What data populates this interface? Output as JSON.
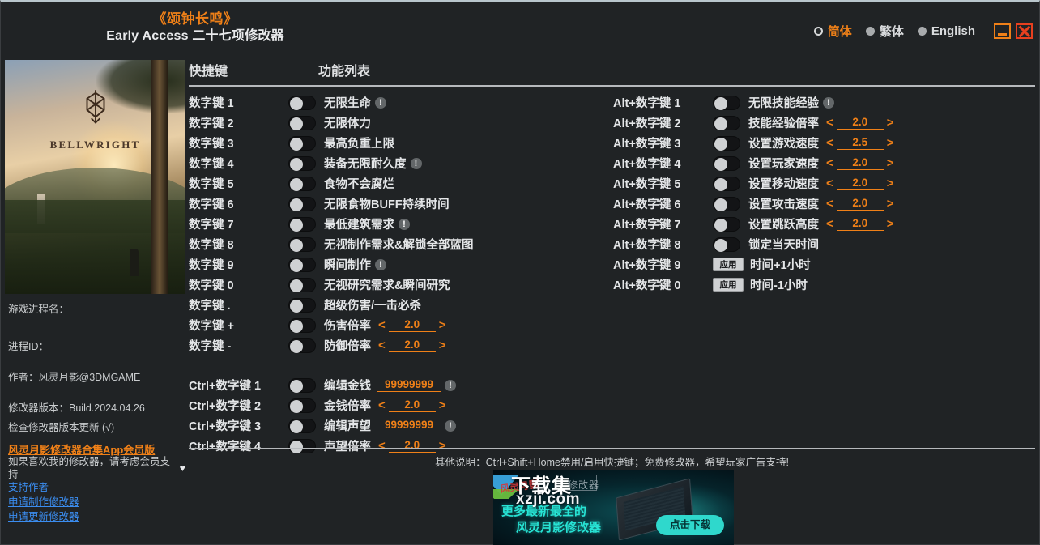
{
  "header": {
    "game_title": "《颂钟长鸣》",
    "sub_title": "Early Access 二十七项修改器",
    "languages": [
      {
        "label": "简体",
        "selected": true
      },
      {
        "label": "繁体",
        "selected": false
      },
      {
        "label": "English",
        "selected": false
      }
    ],
    "minimize_icon": "minimize-icon",
    "close_icon": "close-icon"
  },
  "sidebar": {
    "cover_brand": "BELLWRIGHT",
    "cover_logo_icon": "bell-logo-icon",
    "process_name_label": "游戏进程名：",
    "process_id_label": "进程ID：",
    "author_label": "作者：风灵月影@3DMGAME",
    "version_label": "修改器版本：Build.2024.04.26",
    "check_update_link": "检查修改器版本更新 (√)",
    "vip_app_link": "风灵月影修改器合集App会员版",
    "support_note": "如果喜欢我的修改器，请考虑会员支持",
    "heart_icon": "heart-icon",
    "links": [
      "支持作者",
      "申请制作修改器",
      "申请更新修改器"
    ]
  },
  "main": {
    "col_header_hotkey": "快捷键",
    "col_header_functions": "功能列表",
    "left_rows": [
      {
        "hotkey": "数字键 1",
        "control": "toggle",
        "state": "off",
        "label": "无限生命",
        "warn": true
      },
      {
        "hotkey": "数字键 2",
        "control": "toggle",
        "state": "off",
        "label": "无限体力",
        "warn": false
      },
      {
        "hotkey": "数字键 3",
        "control": "toggle",
        "state": "off",
        "label": "最高负重上限",
        "warn": false
      },
      {
        "hotkey": "数字键 4",
        "control": "toggle",
        "state": "off",
        "label": "装备无限耐久度",
        "warn": true
      },
      {
        "hotkey": "数字键 5",
        "control": "toggle",
        "state": "off",
        "label": "食物不会腐烂",
        "warn": false
      },
      {
        "hotkey": "数字键 6",
        "control": "toggle",
        "state": "off",
        "label": "无限食物BUFF持续时间",
        "warn": false
      },
      {
        "hotkey": "数字键 7",
        "control": "toggle",
        "state": "off",
        "label": "最低建筑需求",
        "warn": true
      },
      {
        "hotkey": "数字键 8",
        "control": "toggle",
        "state": "off",
        "label": "无视制作需求&解锁全部蓝图",
        "warn": false
      },
      {
        "hotkey": "数字键 9",
        "control": "toggle",
        "state": "off",
        "label": "瞬间制作",
        "warn": true
      },
      {
        "hotkey": "数字键 0",
        "control": "toggle",
        "state": "off",
        "label": "无视研究需求&瞬间研究",
        "warn": false
      },
      {
        "hotkey": "数字键 .",
        "control": "toggle",
        "state": "off",
        "label": "超级伤害/一击必杀",
        "warn": false
      },
      {
        "hotkey": "数字键 +",
        "control": "toggle",
        "state": "off",
        "label": "伤害倍率",
        "warn": false,
        "spinner": "2.0"
      },
      {
        "hotkey": "数字键 -",
        "control": "toggle",
        "state": "off",
        "label": "防御倍率",
        "warn": false,
        "spinner": "2.0"
      }
    ],
    "left_rows_group2": [
      {
        "hotkey": "Ctrl+数字键 1",
        "control": "toggle",
        "state": "off",
        "label": "编辑金钱",
        "warn": true,
        "field": "99999999"
      },
      {
        "hotkey": "Ctrl+数字键 2",
        "control": "toggle",
        "state": "off",
        "label": "金钱倍率",
        "warn": false,
        "spinner": "2.0"
      },
      {
        "hotkey": "Ctrl+数字键 3",
        "control": "toggle",
        "state": "off",
        "label": "编辑声望",
        "warn": true,
        "field": "99999999"
      },
      {
        "hotkey": "Ctrl+数字键 4",
        "control": "toggle",
        "state": "off",
        "label": "声望倍率",
        "warn": false,
        "spinner": "2.0"
      }
    ],
    "right_rows": [
      {
        "hotkey": "Alt+数字键 1",
        "control": "toggle",
        "state": "off",
        "label": "无限技能经验",
        "warn": true
      },
      {
        "hotkey": "Alt+数字键 2",
        "control": "toggle",
        "state": "off",
        "label": "技能经验倍率",
        "warn": false,
        "spinner": "2.0"
      },
      {
        "hotkey": "Alt+数字键 3",
        "control": "toggle",
        "state": "off",
        "label": "设置游戏速度",
        "warn": false,
        "spinner": "2.5"
      },
      {
        "hotkey": "Alt+数字键 4",
        "control": "toggle",
        "state": "off",
        "label": "设置玩家速度",
        "warn": false,
        "spinner": "2.0"
      },
      {
        "hotkey": "Alt+数字键 5",
        "control": "toggle",
        "state": "off",
        "label": "设置移动速度",
        "warn": false,
        "spinner": "2.0"
      },
      {
        "hotkey": "Alt+数字键 6",
        "control": "toggle",
        "state": "off",
        "label": "设置攻击速度",
        "warn": false,
        "spinner": "2.0"
      },
      {
        "hotkey": "Alt+数字键 7",
        "control": "toggle",
        "state": "off",
        "label": "设置跳跃高度",
        "warn": false,
        "spinner": "2.0"
      },
      {
        "hotkey": "Alt+数字键 8",
        "control": "toggle",
        "state": "off",
        "label": "锁定当天时间",
        "warn": false
      },
      {
        "hotkey": "Alt+数字键 9",
        "control": "apply",
        "apply_label": "应用",
        "label": "时间+1小时",
        "warn": false
      },
      {
        "hotkey": "Alt+数字键 0",
        "control": "apply",
        "apply_label": "应用",
        "label": "时间-1小时",
        "warn": false
      }
    ]
  },
  "footer": {
    "note": "其他说明：Ctrl+Shift+Home禁用/启用快捷键；免费修改器，希望玩家广告支持!"
  },
  "ad": {
    "brand_text": "修改器",
    "headline1": "更多最新最全的",
    "headline2": "风灵月影修改器",
    "download_button": "点击下载",
    "watermark_main": "下载集",
    "watermark_site": "xzji.com",
    "watermark_logo": "风灵月影"
  },
  "colors": {
    "accent_orange": "#ef8018",
    "link_blue": "#3b8df0",
    "close_red": "#e8401f",
    "ad_teal": "#2fd8cc"
  }
}
